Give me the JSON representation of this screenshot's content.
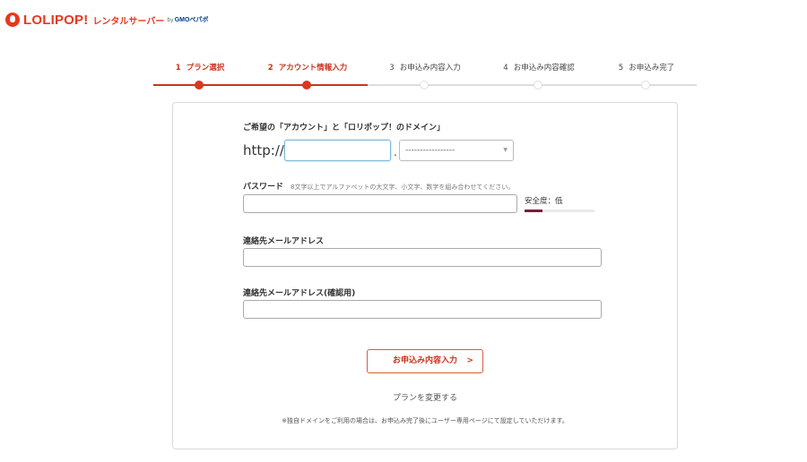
{
  "header": {
    "logo_text": "LOLIPOP!",
    "logo_sub": "レンタルサーバー",
    "logo_by": "by",
    "logo_gmo": "GMOペパボ"
  },
  "stepper": {
    "steps": [
      {
        "num": "1",
        "label": "プラン選択",
        "active": true
      },
      {
        "num": "2",
        "label": "アカウント情報入力",
        "active": true
      },
      {
        "num": "3",
        "label": "お申込み内容入力",
        "active": false
      },
      {
        "num": "4",
        "label": "お申込み内容確認",
        "active": false
      },
      {
        "num": "5",
        "label": "お申込み完了",
        "active": false
      }
    ],
    "progress_fraction": 0.395
  },
  "form": {
    "account_label": "ご希望の「アカウント」と「ロリポップ！のドメイン」",
    "url_prefix": "http://",
    "account_value": "",
    "domain_dot": ".",
    "domain_selected": "-----------------",
    "password_label": "パスワード",
    "password_hint": "8文字以上でアルファベットの大文字、小文字、数字を組み合わせてください。",
    "password_value": "",
    "strength_label": "安全度：低",
    "strength_level": 0.25,
    "email_label": "連絡先メールアドレス",
    "email_value": "",
    "email_confirm_label": "連絡先メールアドレス(確認用)",
    "email_confirm_value": "",
    "submit_label": "お申込み内容入力",
    "submit_chevron": ">",
    "change_plan_label": "プランを変更する",
    "note": "※独自ドメインをご利用の場合は、お申込み完了後にユーザー専用ページにて設定していただけます。"
  },
  "colors": {
    "brand": "#e8381d",
    "step_active": "#d8381f",
    "strength_fill": "#7a1e3a"
  }
}
